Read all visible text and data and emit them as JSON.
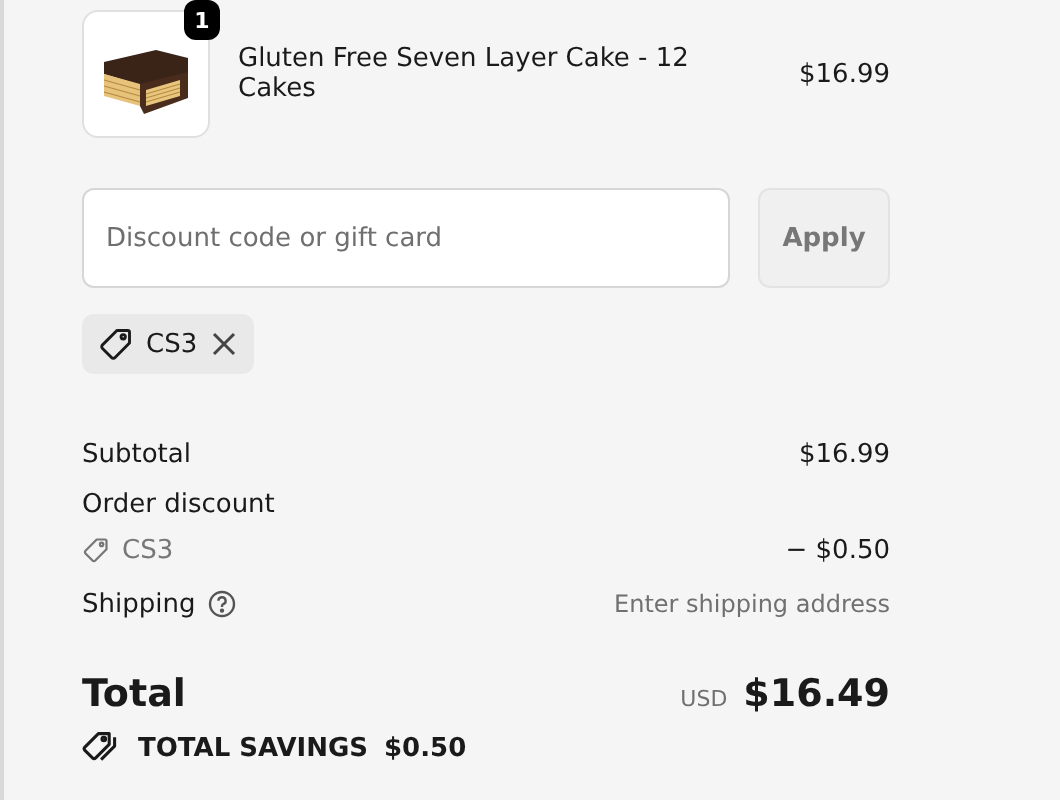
{
  "line_items": [
    {
      "name": "Gluten Free Seven Layer Cake - 12 Cakes",
      "price": "$16.99",
      "quantity": "1"
    }
  ],
  "discount": {
    "placeholder": "Discount code or gift card",
    "button": "Apply",
    "button_disabled": true
  },
  "applied_codes": [
    {
      "code": "CS3"
    }
  ],
  "summary": {
    "subtotal_label": "Subtotal",
    "subtotal": "$16.99",
    "discount_label": "Order discount",
    "discount_code": "CS3",
    "discount_amount": "− $0.50",
    "shipping_label": "Shipping",
    "shipping_value": "Enter shipping address",
    "total_label": "Total",
    "currency": "USD",
    "total": "$16.49",
    "savings_label": "TOTAL SAVINGS",
    "savings": "$0.50"
  }
}
